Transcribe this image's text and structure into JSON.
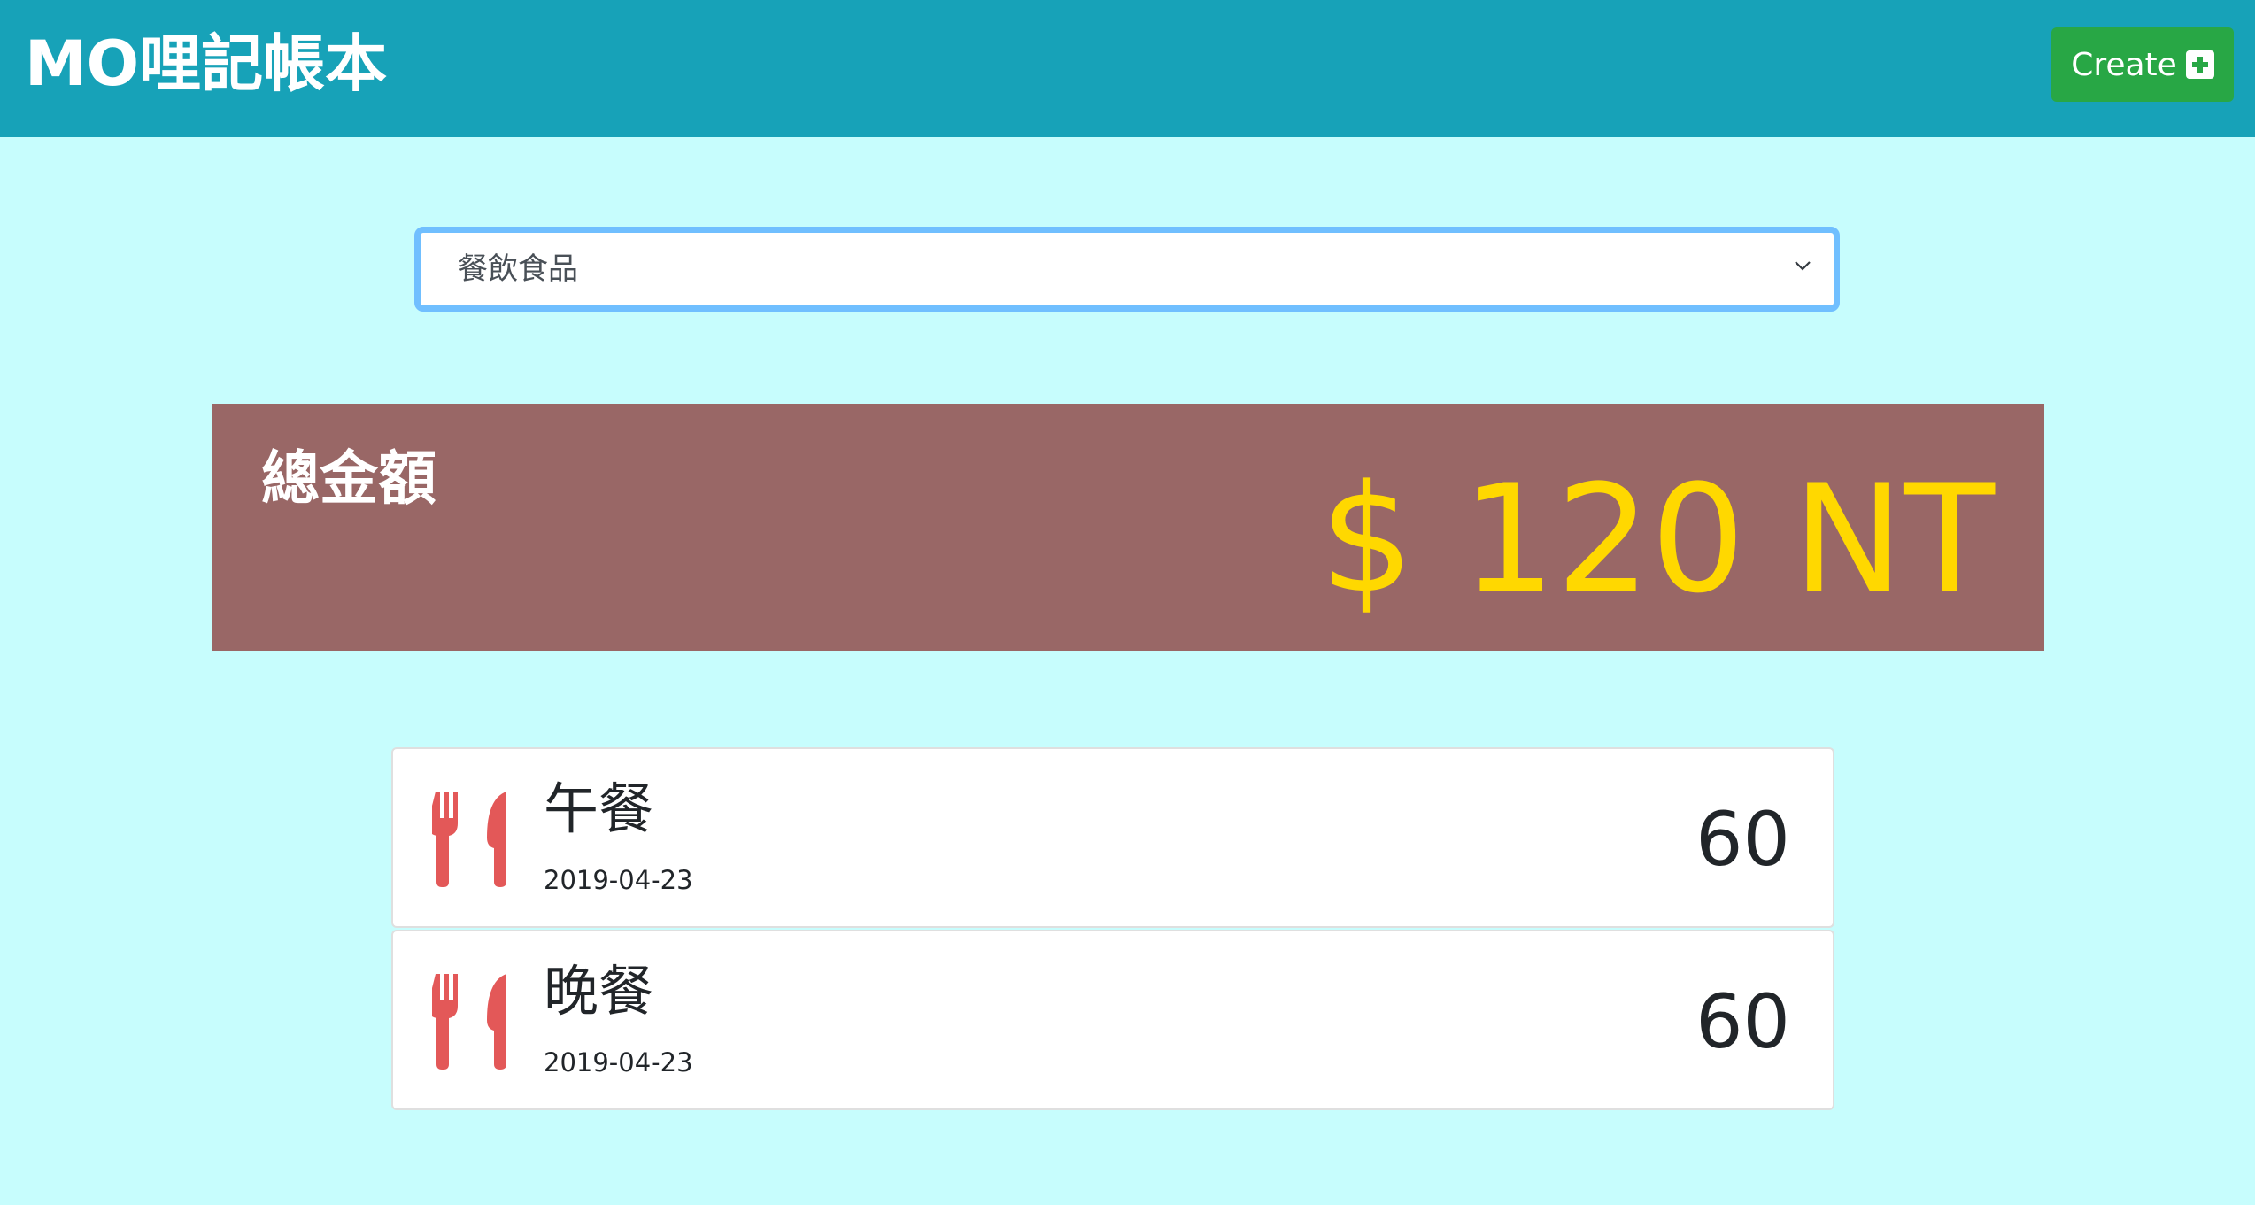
{
  "header": {
    "brand": "MO哩記帳本",
    "create_label": "Create",
    "create_icon": "plus-square-icon"
  },
  "filter": {
    "selected": "餐飲食品",
    "icon": "chevron-down-icon"
  },
  "total": {
    "label": "總金額",
    "amount": "$ 120 NT"
  },
  "items": [
    {
      "title": "午餐",
      "date": "2019-04-23",
      "amount": "60",
      "icon": "utensils-icon"
    },
    {
      "title": "晚餐",
      "date": "2019-04-23",
      "amount": "60",
      "icon": "utensils-icon"
    }
  ],
  "colors": {
    "navbar": "#17a2b8",
    "background": "#c7fdfd",
    "create_button": "#28a745",
    "total_panel": "#996766",
    "total_amount": "#ffd800",
    "icon": "#e35858"
  }
}
